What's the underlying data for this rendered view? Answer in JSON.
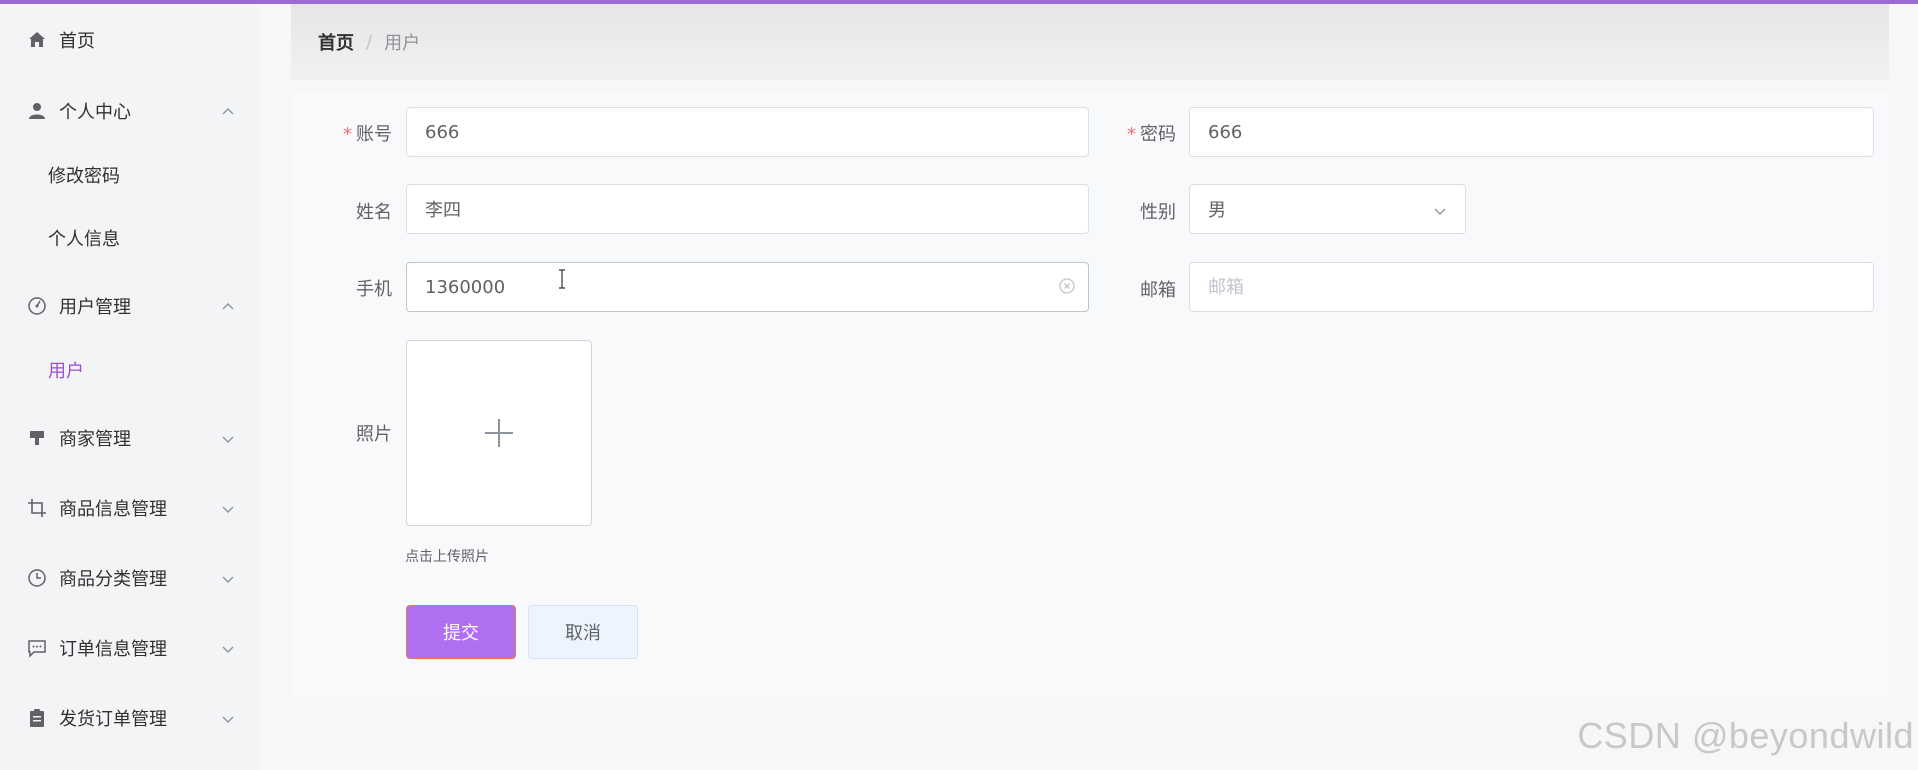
{
  "sidebar": {
    "items": [
      {
        "label": "首页",
        "icon": "home-icon"
      },
      {
        "label": "个人中心",
        "icon": "user-icon",
        "expanded": true,
        "children": [
          {
            "label": "修改密码"
          },
          {
            "label": "个人信息"
          }
        ]
      },
      {
        "label": "用户管理",
        "icon": "dashboard-icon",
        "expanded": true,
        "children": [
          {
            "label": "用户",
            "active": true
          }
        ]
      },
      {
        "label": "商家管理",
        "icon": "brush-icon",
        "expanded": false
      },
      {
        "label": "商品信息管理",
        "icon": "crop-icon",
        "expanded": false
      },
      {
        "label": "商品分类管理",
        "icon": "clock-icon",
        "expanded": false
      },
      {
        "label": "订单信息管理",
        "icon": "chat-icon",
        "expanded": false
      },
      {
        "label": "发货订单管理",
        "icon": "clipboard-icon",
        "expanded": false
      }
    ]
  },
  "breadcrumb": {
    "home": "首页",
    "separator": "/",
    "current": "用户"
  },
  "form": {
    "account": {
      "label": "账号",
      "value": "666",
      "required": "*"
    },
    "password": {
      "label": "密码",
      "value": "666",
      "required": "*"
    },
    "name": {
      "label": "姓名",
      "value": "李四"
    },
    "gender": {
      "label": "性别",
      "value": "男"
    },
    "phone": {
      "label": "手机",
      "value": "1360000"
    },
    "email": {
      "label": "邮箱",
      "value": "",
      "placeholder": "邮箱"
    },
    "photo": {
      "label": "照片",
      "tip": "点击上传照片"
    },
    "submit_label": "提交",
    "cancel_label": "取消"
  },
  "watermark": "CSDN @beyondwild",
  "colors": {
    "accent": "#9b6ad6",
    "primary_button": "#b06ef0",
    "required": "#f56c6c",
    "active_menu": "#9b4fd6"
  }
}
